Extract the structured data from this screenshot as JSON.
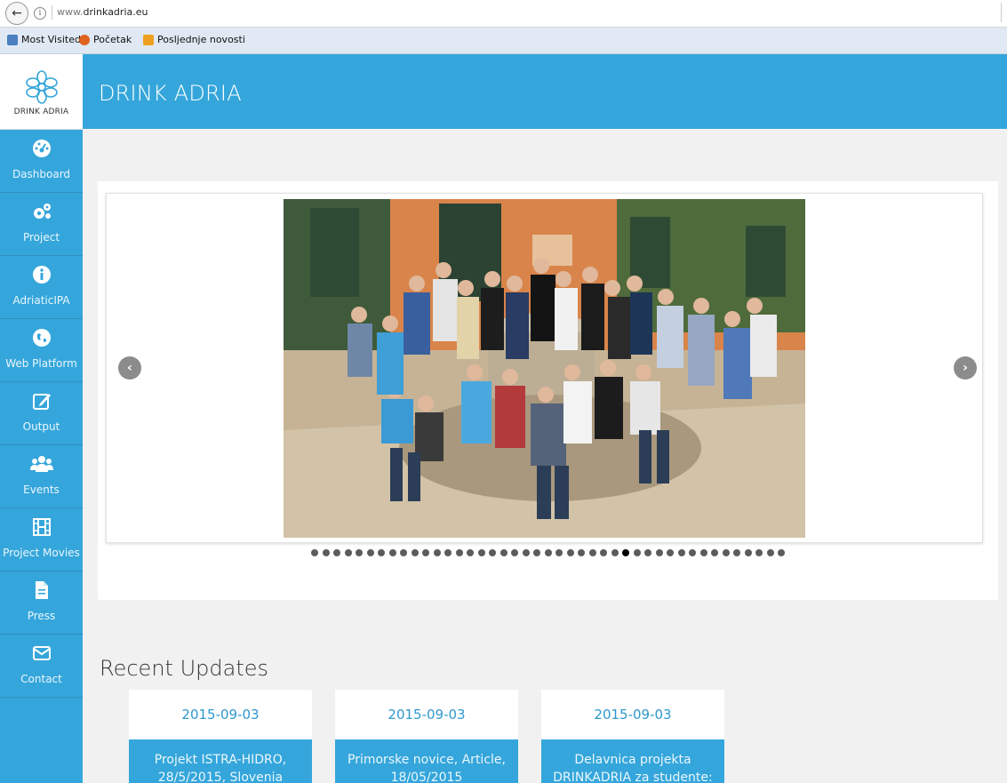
{
  "browser": {
    "url_prefix": "www.",
    "url_domain": "drinkadria.eu",
    "bookmarks": [
      "Most Visited",
      "Početak",
      "Posljednje novosti"
    ]
  },
  "logo_text": "DRINK ADRIA",
  "header": {
    "title": "DRINK ADRIA"
  },
  "nav": [
    {
      "label": "Dashboard",
      "icon": "dashboard-icon"
    },
    {
      "label": "Project",
      "icon": "gears-icon"
    },
    {
      "label": "AdriaticIPA",
      "icon": "info-icon"
    },
    {
      "label": "Web Platform",
      "icon": "globe-icon"
    },
    {
      "label": "Output",
      "icon": "edit-icon"
    },
    {
      "label": "Events",
      "icon": "users-icon"
    },
    {
      "label": "Project Movies",
      "icon": "film-icon"
    },
    {
      "label": "Press",
      "icon": "file-icon"
    },
    {
      "label": "Contact",
      "icon": "envelope-icon"
    }
  ],
  "carousel": {
    "total_slides": 43,
    "active_index": 28
  },
  "recent": {
    "title": "Recent Updates",
    "cards": [
      {
        "date": "2015-09-03",
        "line1": "Projekt ISTRA-HIDRO,",
        "line2": "28/5/2015, Slovenia"
      },
      {
        "date": "2015-09-03",
        "line1": "Primorske novice, Article,",
        "line2": "18/05/2015"
      },
      {
        "date": "2015-09-03",
        "line1": "Delavnica projekta",
        "line2": "DRINKADRIA za studente:"
      }
    ]
  },
  "colors": {
    "brand": "#35a6db",
    "date_text": "#2f97cf"
  }
}
